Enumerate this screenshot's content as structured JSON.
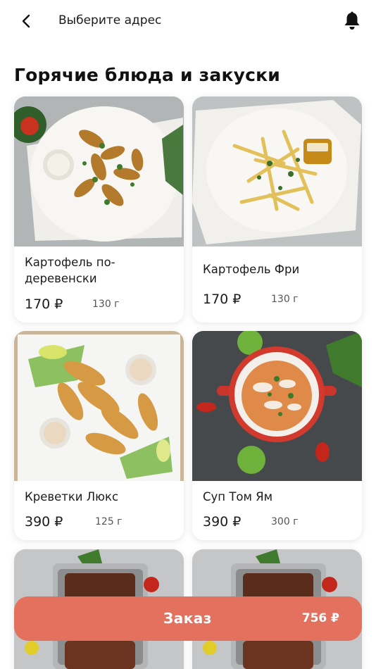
{
  "header": {
    "back_icon": "chevron-left-icon",
    "address_label": "Выберите адрес",
    "bell_icon": "bell-icon"
  },
  "section": {
    "title": "Горячие блюда и закуски"
  },
  "products": [
    {
      "name": "Картофель по-деревенски",
      "price": "170 ₽",
      "weight": "130 г"
    },
    {
      "name": "Картофель Фри",
      "price": "170 ₽",
      "weight": "130 г"
    },
    {
      "name": "Креветки Люкс",
      "price": "390 ₽",
      "weight": "125 г"
    },
    {
      "name": "Суп Том Ям",
      "price": "390 ₽",
      "weight": "300 г"
    }
  ],
  "order": {
    "label": "Заказ",
    "total": "756 ₽"
  },
  "colors": {
    "accent": "#e4705e",
    "text": "#1b1b1b",
    "muted": "#555555"
  }
}
